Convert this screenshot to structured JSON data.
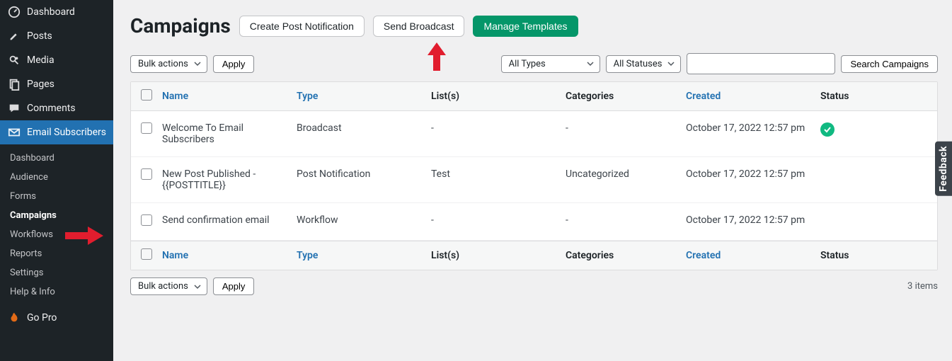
{
  "sidebar": {
    "top": [
      {
        "icon": "dashboard",
        "label": "Dashboard"
      },
      {
        "icon": "pin",
        "label": "Posts"
      },
      {
        "icon": "media",
        "label": "Media"
      },
      {
        "icon": "pages",
        "label": "Pages"
      },
      {
        "icon": "comment",
        "label": "Comments"
      }
    ],
    "active": {
      "icon": "mail",
      "label": "Email Subscribers"
    },
    "submenu": [
      "Dashboard",
      "Audience",
      "Forms",
      "Campaigns",
      "Workflows",
      "Reports",
      "Settings",
      "Help & Info"
    ],
    "submenu_current": "Campaigns",
    "gopro": {
      "icon": "fire",
      "label": "Go Pro"
    }
  },
  "page": {
    "title": "Campaigns",
    "buttons": {
      "create": "Create Post Notification",
      "broadcast": "Send Broadcast",
      "templates": "Manage Templates"
    },
    "bulk_label": "Bulk actions",
    "apply_label": "Apply",
    "filter_types": "All Types",
    "filter_statuses": "All Statuses",
    "search_label": "Search Campaigns",
    "columns": {
      "name": "Name",
      "type": "Type",
      "lists": "List(s)",
      "cats": "Categories",
      "created": "Created",
      "status": "Status"
    },
    "rows": [
      {
        "name": "Welcome To Email Subscribers",
        "type": "Broadcast",
        "lists": "-",
        "cats": "-",
        "created": "October 17, 2022 12:57 pm",
        "status": "check"
      },
      {
        "name": "New Post Published - {{POSTTITLE}}",
        "type": "Post Notification",
        "lists": "Test",
        "cats": "Uncategorized",
        "created": "October 17, 2022 12:57 pm",
        "status": "off"
      },
      {
        "name": "Send confirmation email",
        "type": "Workflow",
        "lists": "-",
        "cats": "-",
        "created": "October 17, 2022 12:57 pm",
        "status": "on"
      }
    ],
    "items_count": "3 items",
    "feedback": "Feedback"
  }
}
